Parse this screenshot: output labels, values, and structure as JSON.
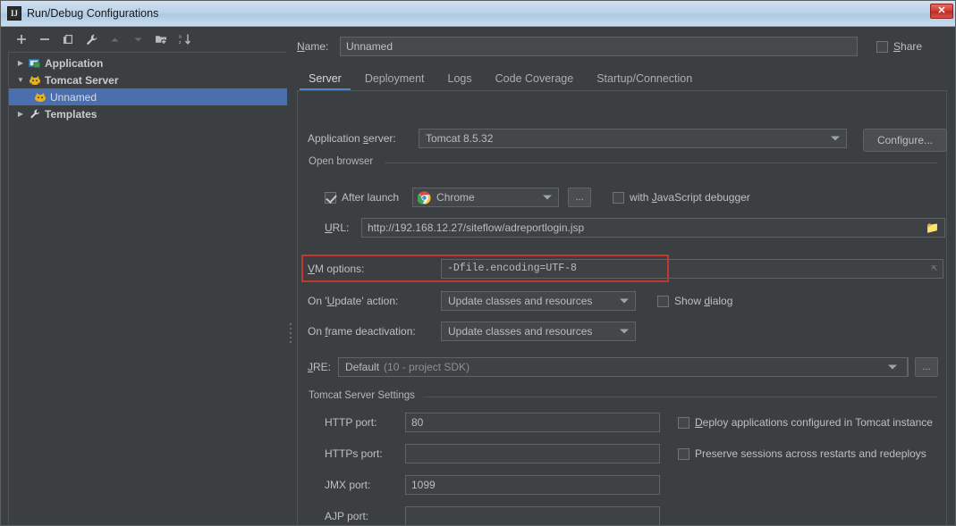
{
  "window": {
    "title": "Run/Debug Configurations",
    "app_icon": "IJ",
    "close_label": "✕"
  },
  "toolbar": {
    "items": [
      {
        "name": "add-icon",
        "glyph": "+",
        "enabled": true
      },
      {
        "name": "remove-icon",
        "glyph": "−",
        "enabled": true
      },
      {
        "name": "copy-icon",
        "glyph": "copy",
        "enabled": true
      },
      {
        "name": "wrench-icon",
        "glyph": "wrench",
        "enabled": true
      },
      {
        "name": "move-up-icon",
        "glyph": "up",
        "enabled": false
      },
      {
        "name": "move-down-icon",
        "glyph": "down",
        "enabled": false
      },
      {
        "name": "new-folder-icon",
        "glyph": "folder-plus",
        "enabled": true
      },
      {
        "name": "sort-alphabetically-icon",
        "glyph": "sort-az",
        "enabled": true
      }
    ]
  },
  "tree": {
    "nodes": [
      {
        "label": "Application",
        "arrow": "▶",
        "icon": "application-icon",
        "level": 0,
        "selected": false
      },
      {
        "label": "Tomcat Server",
        "arrow": "▼",
        "icon": "tomcat-icon",
        "level": 0,
        "selected": false
      },
      {
        "label": "Unnamed",
        "arrow": "",
        "icon": "tomcat-icon",
        "level": 1,
        "selected": true
      },
      {
        "label": "Templates",
        "arrow": "▶",
        "icon": "wrench-icon",
        "level": 0,
        "selected": false
      }
    ]
  },
  "header": {
    "name_label": "Name:",
    "name_label_mnemonic": "N",
    "name_value": "Unnamed",
    "name_placeholder": "Unnamed",
    "share_label": "Share",
    "share_mnemonic": "S",
    "share_checked": false
  },
  "tabs": [
    {
      "label": "Server",
      "active": true
    },
    {
      "label": "Deployment",
      "active": false
    },
    {
      "label": "Logs",
      "active": false
    },
    {
      "label": "Code Coverage",
      "active": false
    },
    {
      "label": "Startup/Connection",
      "active": false
    }
  ],
  "server_tab": {
    "application_server": {
      "label": "Application server:",
      "mnemonic": "s",
      "value": "Tomcat 8.5.32"
    },
    "configure_button": "Configure...",
    "open_browser": {
      "group_title": "Open browser",
      "after_launch_label": "After launch",
      "after_launch_checked": true,
      "browser_value": "Chrome",
      "browser_icon": "chrome-icon",
      "ellipsis_button": "...",
      "js_debugger_label": "with JavaScript debugger",
      "js_debugger_mnemonic": "J",
      "js_debugger_checked": false,
      "url_label": "URL:",
      "url_mnemonic": "U",
      "url_value": "http://192.168.12.27/siteflow/adreportlogin.jsp",
      "url_browse_icon": "folder-icon"
    },
    "vm_options": {
      "label": "VM options:",
      "mnemonic": "V",
      "value": "-Dfile.encoding=UTF-8",
      "expand_icon": "expand-icon",
      "highlight_color": "#c0392b",
      "highlighted": true
    },
    "on_update_action": {
      "label": "On 'Update' action:",
      "mnemonic": "U",
      "value": "Update classes and resources",
      "show_dialog_label": "Show dialog",
      "show_dialog_mnemonic": "d",
      "show_dialog_checked": false
    },
    "on_frame_deactivation": {
      "label": "On frame deactivation:",
      "mnemonic": "f",
      "value": "Update classes and resources"
    },
    "jre": {
      "label": "JRE:",
      "mnemonic": "J",
      "value": "Default",
      "hint": "(10 - project SDK)",
      "browse_button": "..."
    },
    "tomcat_settings": {
      "group_title": "Tomcat Server Settings",
      "fields": [
        {
          "name": "http-port",
          "label": "HTTP port:",
          "value": "80"
        },
        {
          "name": "https-port",
          "label": "HTTPs port:",
          "value": ""
        },
        {
          "name": "jmx-port",
          "label": "JMX port:",
          "value": "1099"
        },
        {
          "name": "ajp-port",
          "label": "AJP port:",
          "value": ""
        }
      ],
      "checkboxes": [
        {
          "name": "deploy-applications",
          "label": "Deploy applications configured in Tomcat instance",
          "mnemonic": "D",
          "checked": false
        },
        {
          "name": "preserve-sessions",
          "label": "Preserve sessions across restarts and redeploys",
          "checked": false
        }
      ]
    }
  },
  "colors": {
    "background": "#3c3f41",
    "field_background": "#45494a",
    "border": "#5e6366",
    "text": "#bcc0c2",
    "selection": "#4b6eaf",
    "tab_accent": "#4a88c7",
    "highlight_red": "#c0392b"
  }
}
